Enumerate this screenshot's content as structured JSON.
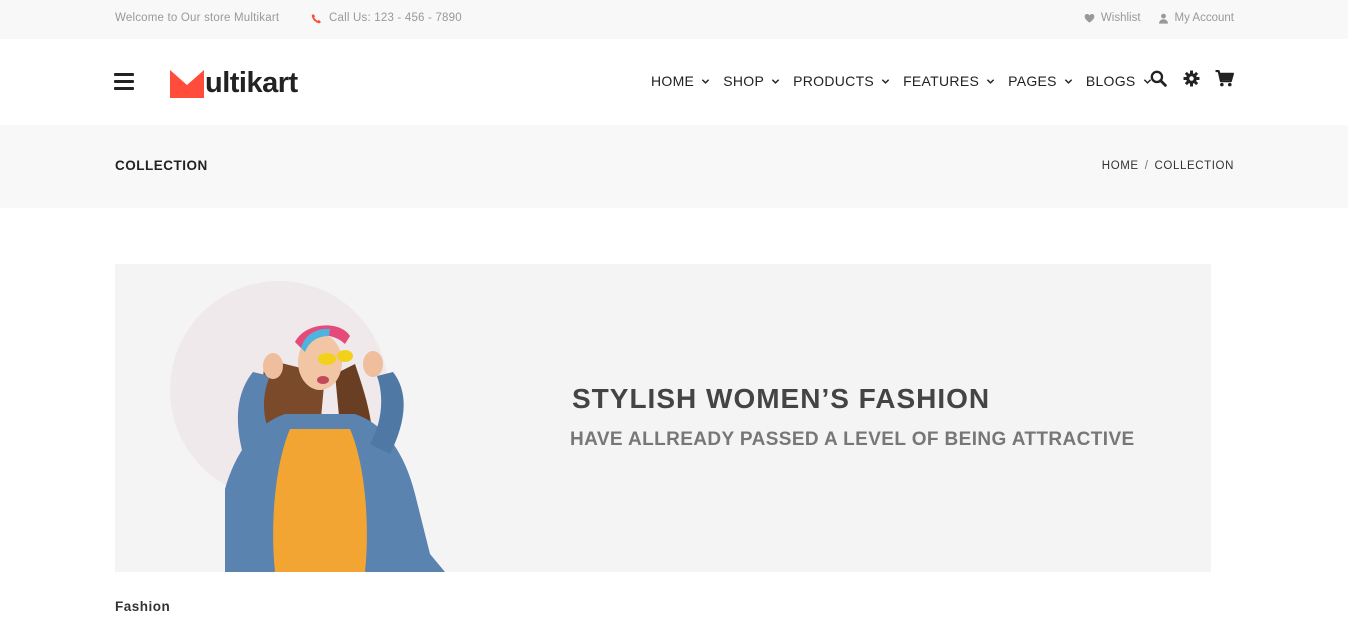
{
  "topbar": {
    "welcome": "Welcome to Our store Multikart",
    "call": "Call Us: 123 - 456 - 7890",
    "wishlist": "Wishlist",
    "account": "My Account",
    "phone_icon": "phone-icon",
    "heart_icon": "heart-icon",
    "user_icon": "user-icon"
  },
  "header": {
    "logo_text": "ultikart",
    "logo_icon": "logo-m-mark",
    "brand_color": "#ff4c3b",
    "nav": [
      {
        "label": "HOME"
      },
      {
        "label": "SHOP"
      },
      {
        "label": "PRODUCTS"
      },
      {
        "label": "FEATURES"
      },
      {
        "label": "PAGES"
      },
      {
        "label": "BLOGS"
      }
    ],
    "icons": [
      "search-icon",
      "gear-icon",
      "cart-icon"
    ]
  },
  "breadcrumb": {
    "title": "COLLECTION",
    "items": [
      "HOME",
      "COLLECTION"
    ],
    "separator": "/"
  },
  "banner": {
    "headline": "STYLISH WOMEN’S FASHION",
    "subline": "HAVE ALLREADY PASSED A LEVEL OF BEING ATTRACTIVE"
  },
  "section": {
    "label": "Fashion"
  }
}
